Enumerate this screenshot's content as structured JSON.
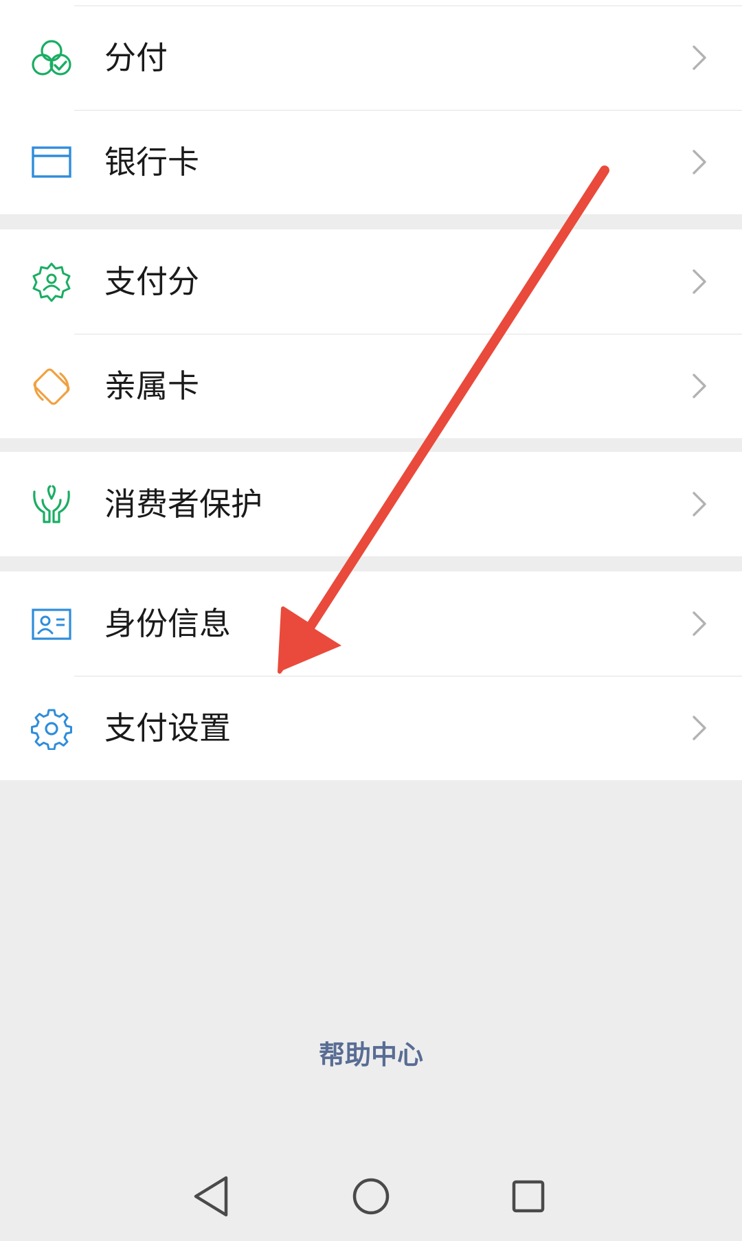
{
  "menu": {
    "group1": [
      {
        "label": "分付",
        "icon": "fenfu-circles-icon",
        "color": "#1aad63"
      },
      {
        "label": "银行卡",
        "icon": "bank-card-icon",
        "color": "#2e8ddb"
      }
    ],
    "group2": [
      {
        "label": "支付分",
        "icon": "pay-score-badge-icon",
        "color": "#1aad63"
      },
      {
        "label": "亲属卡",
        "icon": "family-card-icon",
        "color": "#f0a141"
      }
    ],
    "group3": [
      {
        "label": "消费者保护",
        "icon": "hands-protect-icon",
        "color": "#1aad63"
      }
    ],
    "group4": [
      {
        "label": "身份信息",
        "icon": "id-card-icon",
        "color": "#2e8ddb"
      },
      {
        "label": "支付设置",
        "icon": "gear-icon",
        "color": "#2e8ddb"
      }
    ]
  },
  "footer": {
    "help_center": "帮助中心",
    "link_color": "#586c94"
  },
  "navbar": {
    "buttons": [
      "back-triangle-icon",
      "home-circle-icon",
      "recents-square-icon"
    ]
  },
  "annotation": {
    "arrow_color": "#e94a3b",
    "arrow_target": "支付设置"
  },
  "colors": {
    "background": "#ededed",
    "card": "#ffffff",
    "divider": "#e2e2e2",
    "chevron": "#b2b2b2"
  }
}
